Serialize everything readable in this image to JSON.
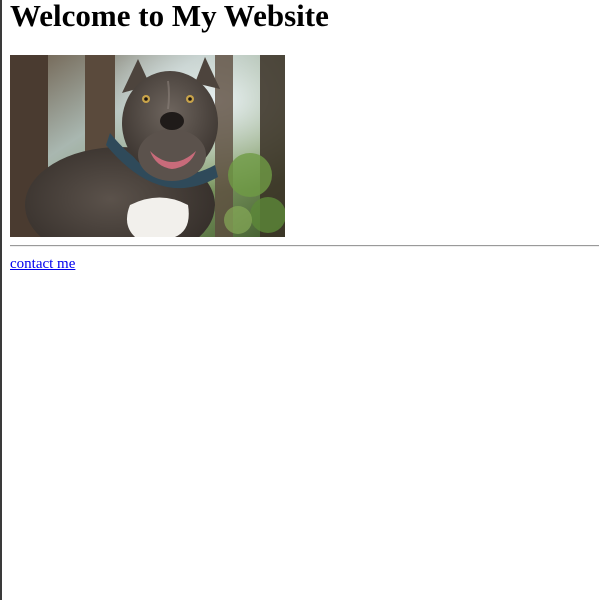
{
  "page": {
    "title": "Welcome to My Website"
  },
  "image": {
    "subject": "dog-photo"
  },
  "links": {
    "contact": "contact me"
  },
  "colors": {
    "link": "#0000ee",
    "divider": "#9a9a9a",
    "left_edge": "#3a3a3a"
  }
}
